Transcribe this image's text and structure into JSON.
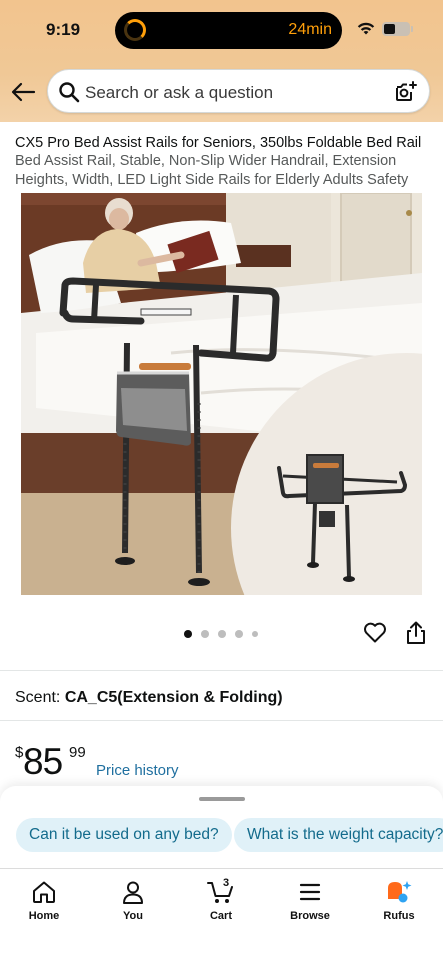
{
  "status_bar": {
    "time": "9:19",
    "timer": "24min",
    "battery_level": 0.45
  },
  "header": {
    "search_placeholder": "Search or ask a question",
    "back_icon": "arrow-left-icon",
    "camera_icon": "camera-search-icon"
  },
  "product": {
    "title_main": "CX5 Pro Bed Assist Rails for Seniors, 350lbs Foldable Bed Rail",
    "title_sub": "Bed Assist Rail, Stable, Non-Slip Wider Handrail, Extension Heights, Width, LED Light Side Rails for Elderly Adults Safety",
    "image_count": 5,
    "active_image": 0,
    "scent_label": "Scent:",
    "scent_value": "CA_C5(Extension & Folding)",
    "price_symbol": "$",
    "price_whole": "85",
    "price_fraction": "99",
    "price_history": "Price history"
  },
  "sheet": {
    "chips": [
      "Can it be used on any bed?",
      "What is the weight capacity?"
    ]
  },
  "tabbar": {
    "tabs": [
      {
        "label": "Home",
        "icon": "home-icon"
      },
      {
        "label": "You",
        "icon": "person-icon"
      },
      {
        "label": "Cart",
        "icon": "cart-icon",
        "count": "3"
      },
      {
        "label": "Browse",
        "icon": "menu-icon"
      },
      {
        "label": "Rufus",
        "icon": "rufus-icon"
      }
    ]
  },
  "colors": {
    "header_bg": "#f2c48e",
    "link": "#1f6f9f",
    "chip_bg": "#e0f1f8",
    "chip_text": "#136b8c",
    "timer_orange": "#ff9f0a",
    "rufus_orange": "#ff6a1a",
    "rufus_blue": "#2ea3f2"
  }
}
